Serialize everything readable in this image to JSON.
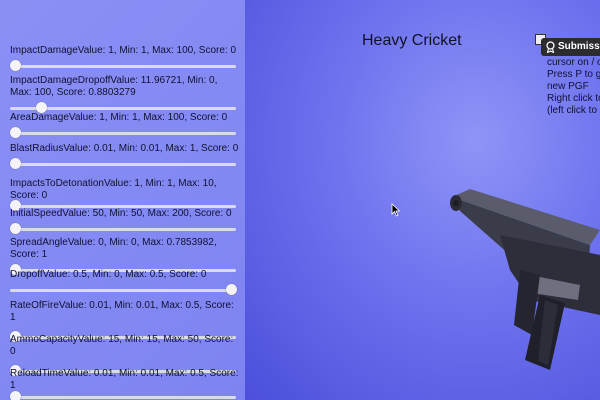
{
  "scene": {
    "weapon_name": "Heavy Cricket",
    "submit_label": "Submission",
    "info_lines": [
      "cursor on / o",
      "Press P to g",
      "new PGF",
      "Right click to",
      "(left click to"
    ]
  },
  "icons": {
    "cursor": "mouse-pointer-icon",
    "badge": "ribbon-badge-icon",
    "weapon": "gun-model"
  },
  "params": [
    {
      "label": "ImpactDamageValue: 1, Min: 1, Max: 100, Score: 0",
      "value": 0.0
    },
    {
      "label": "ImpactDamageDropoffValue: 11.96721, Min: 0, Max: 100, Score: 0.8803279",
      "value": 0.1197
    },
    {
      "label": "AreaDamageValue: 1, Min: 1, Max: 100, Score: 0",
      "value": 0.0
    },
    {
      "label": "BlastRadiusValue: 0.01, Min: 0.01, Max: 1, Score: 0",
      "value": 0.0
    },
    {
      "label": "ImpactsToDetonationValue: 1, Min: 1, Max: 10, Score: 0",
      "value": 0.0
    },
    {
      "label": "InitialSpeedValue: 50, Min: 50, Max: 200, Score: 0",
      "value": 0.0
    },
    {
      "label": "SpreadAngleValue: 0, Min: 0, Max: 0.7853982, Score: 1",
      "value": 0.0
    },
    {
      "label": "DropoffValue: 0.5, Min: 0, Max: 0.5, Score: 0",
      "value": 1.0
    },
    {
      "label": "RateOfFireValue: 0.01, Min: 0.01, Max: 0.5, Score: 1",
      "value": 0.0
    },
    {
      "label": "AmmoCapacityValue: 15, Min: 15, Max: 50, Score: 0",
      "value": 0.0
    },
    {
      "label": "ReloadTimeValue: 0.01, Min: 0.01, Max: 0.5, Score: 1",
      "value": 0.0
    }
  ]
}
